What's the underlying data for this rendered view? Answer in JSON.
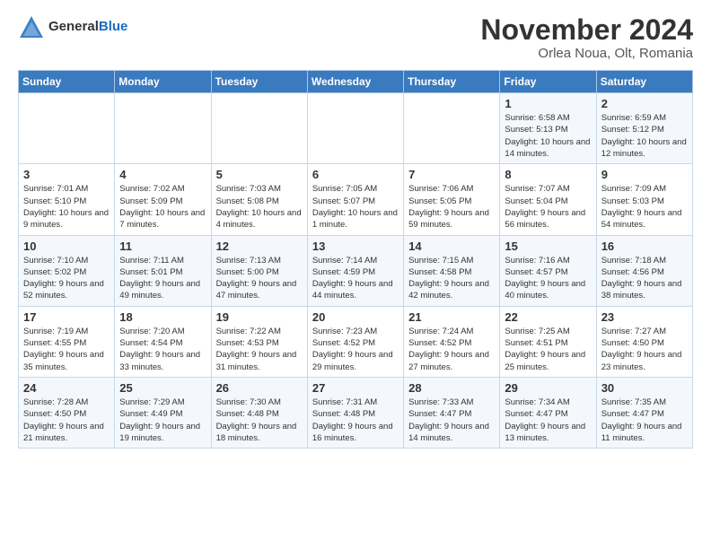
{
  "logo": {
    "general": "General",
    "blue": "Blue"
  },
  "title": "November 2024",
  "location": "Orlea Noua, Olt, Romania",
  "days_header": [
    "Sunday",
    "Monday",
    "Tuesday",
    "Wednesday",
    "Thursday",
    "Friday",
    "Saturday"
  ],
  "weeks": [
    [
      {
        "day": "",
        "detail": ""
      },
      {
        "day": "",
        "detail": ""
      },
      {
        "day": "",
        "detail": ""
      },
      {
        "day": "",
        "detail": ""
      },
      {
        "day": "",
        "detail": ""
      },
      {
        "day": "1",
        "detail": "Sunrise: 6:58 AM\nSunset: 5:13 PM\nDaylight: 10 hours and 14 minutes."
      },
      {
        "day": "2",
        "detail": "Sunrise: 6:59 AM\nSunset: 5:12 PM\nDaylight: 10 hours and 12 minutes."
      }
    ],
    [
      {
        "day": "3",
        "detail": "Sunrise: 7:01 AM\nSunset: 5:10 PM\nDaylight: 10 hours and 9 minutes."
      },
      {
        "day": "4",
        "detail": "Sunrise: 7:02 AM\nSunset: 5:09 PM\nDaylight: 10 hours and 7 minutes."
      },
      {
        "day": "5",
        "detail": "Sunrise: 7:03 AM\nSunset: 5:08 PM\nDaylight: 10 hours and 4 minutes."
      },
      {
        "day": "6",
        "detail": "Sunrise: 7:05 AM\nSunset: 5:07 PM\nDaylight: 10 hours and 1 minute."
      },
      {
        "day": "7",
        "detail": "Sunrise: 7:06 AM\nSunset: 5:05 PM\nDaylight: 9 hours and 59 minutes."
      },
      {
        "day": "8",
        "detail": "Sunrise: 7:07 AM\nSunset: 5:04 PM\nDaylight: 9 hours and 56 minutes."
      },
      {
        "day": "9",
        "detail": "Sunrise: 7:09 AM\nSunset: 5:03 PM\nDaylight: 9 hours and 54 minutes."
      }
    ],
    [
      {
        "day": "10",
        "detail": "Sunrise: 7:10 AM\nSunset: 5:02 PM\nDaylight: 9 hours and 52 minutes."
      },
      {
        "day": "11",
        "detail": "Sunrise: 7:11 AM\nSunset: 5:01 PM\nDaylight: 9 hours and 49 minutes."
      },
      {
        "day": "12",
        "detail": "Sunrise: 7:13 AM\nSunset: 5:00 PM\nDaylight: 9 hours and 47 minutes."
      },
      {
        "day": "13",
        "detail": "Sunrise: 7:14 AM\nSunset: 4:59 PM\nDaylight: 9 hours and 44 minutes."
      },
      {
        "day": "14",
        "detail": "Sunrise: 7:15 AM\nSunset: 4:58 PM\nDaylight: 9 hours and 42 minutes."
      },
      {
        "day": "15",
        "detail": "Sunrise: 7:16 AM\nSunset: 4:57 PM\nDaylight: 9 hours and 40 minutes."
      },
      {
        "day": "16",
        "detail": "Sunrise: 7:18 AM\nSunset: 4:56 PM\nDaylight: 9 hours and 38 minutes."
      }
    ],
    [
      {
        "day": "17",
        "detail": "Sunrise: 7:19 AM\nSunset: 4:55 PM\nDaylight: 9 hours and 35 minutes."
      },
      {
        "day": "18",
        "detail": "Sunrise: 7:20 AM\nSunset: 4:54 PM\nDaylight: 9 hours and 33 minutes."
      },
      {
        "day": "19",
        "detail": "Sunrise: 7:22 AM\nSunset: 4:53 PM\nDaylight: 9 hours and 31 minutes."
      },
      {
        "day": "20",
        "detail": "Sunrise: 7:23 AM\nSunset: 4:52 PM\nDaylight: 9 hours and 29 minutes."
      },
      {
        "day": "21",
        "detail": "Sunrise: 7:24 AM\nSunset: 4:52 PM\nDaylight: 9 hours and 27 minutes."
      },
      {
        "day": "22",
        "detail": "Sunrise: 7:25 AM\nSunset: 4:51 PM\nDaylight: 9 hours and 25 minutes."
      },
      {
        "day": "23",
        "detail": "Sunrise: 7:27 AM\nSunset: 4:50 PM\nDaylight: 9 hours and 23 minutes."
      }
    ],
    [
      {
        "day": "24",
        "detail": "Sunrise: 7:28 AM\nSunset: 4:50 PM\nDaylight: 9 hours and 21 minutes."
      },
      {
        "day": "25",
        "detail": "Sunrise: 7:29 AM\nSunset: 4:49 PM\nDaylight: 9 hours and 19 minutes."
      },
      {
        "day": "26",
        "detail": "Sunrise: 7:30 AM\nSunset: 4:48 PM\nDaylight: 9 hours and 18 minutes."
      },
      {
        "day": "27",
        "detail": "Sunrise: 7:31 AM\nSunset: 4:48 PM\nDaylight: 9 hours and 16 minutes."
      },
      {
        "day": "28",
        "detail": "Sunrise: 7:33 AM\nSunset: 4:47 PM\nDaylight: 9 hours and 14 minutes."
      },
      {
        "day": "29",
        "detail": "Sunrise: 7:34 AM\nSunset: 4:47 PM\nDaylight: 9 hours and 13 minutes."
      },
      {
        "day": "30",
        "detail": "Sunrise: 7:35 AM\nSunset: 4:47 PM\nDaylight: 9 hours and 11 minutes."
      }
    ]
  ]
}
